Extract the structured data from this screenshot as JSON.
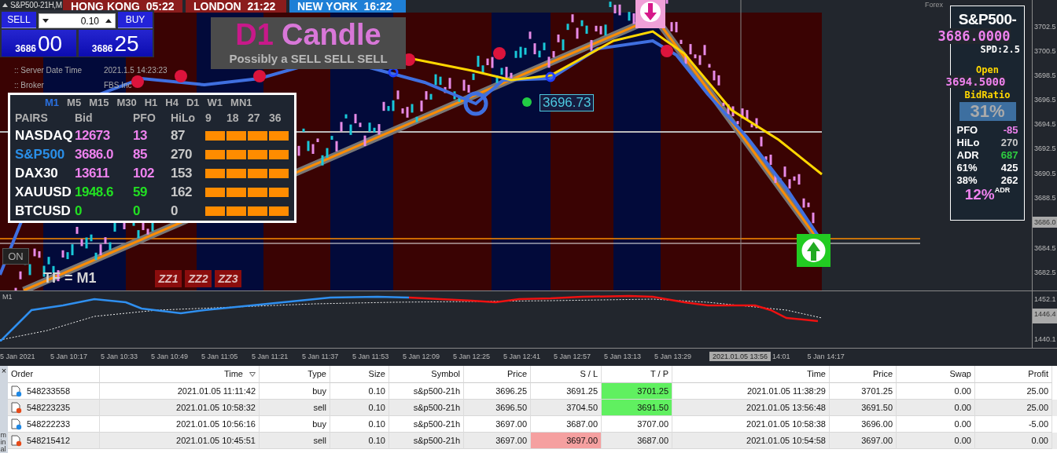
{
  "symbol_title": "S&P500-21H,M",
  "sessions": [
    {
      "city": "HONG KONG",
      "time": "05:22",
      "color": "#8b1c1c"
    },
    {
      "city": "LONDON",
      "time": "21:22",
      "color": "#8b1c1c"
    },
    {
      "city": "NEW YORK",
      "time": "16:22",
      "color": "#1e7fd6"
    }
  ],
  "trade_panel": {
    "sell": "SELL",
    "buy": "BUY",
    "lot": "0.10",
    "bid_main": "3686",
    "bid_pips": "00",
    "ask_main": "3686",
    "ask_pips": "25"
  },
  "banner": {
    "title_parts": [
      {
        "text": "D1",
        "color": "#c8198a"
      },
      {
        "text": "Candle",
        "color": "#d877d8"
      }
    ],
    "subtitle": "Possibly a SELL SELL SELL"
  },
  "info_lines": [
    {
      "label": ":: Server Date Time",
      "value": "2021.1.5   14:23:23"
    },
    {
      "label": ":: Broker",
      "value": "FBS Inc"
    }
  ],
  "dashboard": {
    "timeframes": [
      {
        "label": "M1",
        "selected": true
      },
      {
        "label": "M5",
        "selected": false
      },
      {
        "label": "M15",
        "selected": false
      },
      {
        "label": "M30",
        "selected": false
      },
      {
        "label": "H1",
        "selected": false
      },
      {
        "label": "H4",
        "selected": false
      },
      {
        "label": "D1",
        "selected": false
      },
      {
        "label": "W1",
        "selected": false
      },
      {
        "label": "MN1",
        "selected": false
      }
    ],
    "headers": [
      "PAIRS",
      "Bid",
      "PFO",
      "HiLo",
      "9",
      "18",
      "27",
      "36"
    ],
    "rows": [
      {
        "pair": "NASDAQ",
        "bid": "12673",
        "pfo": "13",
        "hilo": "87",
        "selected": false,
        "color": "#ee82ee",
        "signals": [
          {
            "color": "#ff8c00"
          },
          {
            "color": "#ff8c00"
          },
          {
            "color": "#ff8c00"
          },
          {
            "color": "#ff8c00"
          }
        ]
      },
      {
        "pair": "S&P500",
        "bid": "3686.0",
        "pfo": "85",
        "hilo": "270",
        "selected": true,
        "color": "#ee82ee",
        "signals": [
          {
            "color": "#ff8c00"
          },
          {
            "color": "#ff8c00"
          },
          {
            "color": "#ff8c00"
          },
          {
            "color": "#ff8c00"
          }
        ]
      },
      {
        "pair": "DAX30",
        "bid": "13611",
        "pfo": "102",
        "hilo": "153",
        "selected": false,
        "color": "#ee82ee",
        "signals": [
          {
            "color": "#ff8c00"
          },
          {
            "color": "#ff8c00"
          },
          {
            "color": "#ff8c00"
          },
          {
            "color": "#ff8c00"
          }
        ]
      },
      {
        "pair": "XAUUSD",
        "bid": "1948.6",
        "pfo": "59",
        "hilo": "162",
        "selected": false,
        "color": "#22e022",
        "signals": [
          {
            "color": "#ff8c00"
          },
          {
            "color": "#ff8c00"
          },
          {
            "color": "#ff8c00"
          },
          {
            "color": "#ff8c00"
          }
        ]
      },
      {
        "pair": "BTCUSD",
        "bid": "0",
        "pfo": "0",
        "hilo": "0",
        "selected": false,
        "color": "#22e022",
        "signals": [
          {
            "color": "#ff8c00"
          },
          {
            "color": "#ff8c00"
          },
          {
            "color": "#ff8c00"
          },
          {
            "color": "#ff8c00"
          }
        ]
      }
    ]
  },
  "on_button": "ON",
  "tf_label": "TF = M1",
  "zz_buttons": [
    "ZZ1",
    "ZZ2",
    "ZZ3"
  ],
  "price_marker": "3696.73",
  "forex_label": "Forex",
  "price_axis": [
    {
      "text": "3702.5",
      "highlighted": false
    },
    {
      "text": "3700.5",
      "highlighted": false
    },
    {
      "text": "3698.5",
      "highlighted": false
    },
    {
      "text": "3696.5",
      "highlighted": false
    },
    {
      "text": "3694.5",
      "highlighted": false
    },
    {
      "text": "3692.5",
      "highlighted": false
    },
    {
      "text": "3690.5",
      "highlighted": false
    },
    {
      "text": "3688.5",
      "highlighted": false
    },
    {
      "text": "3686.0",
      "highlighted": true
    },
    {
      "text": "3684.5",
      "highlighted": false
    },
    {
      "text": "3682.5",
      "highlighted": false
    }
  ],
  "side_panel": {
    "symbol": "S&P500-",
    "price": "3686.0000",
    "spread": "SPD:2.5",
    "open_label": "Open",
    "open": "3694.5000",
    "ratio_label": "BidRatio",
    "ratio": "31%",
    "stats": [
      {
        "label": "PFO",
        "value": "-85",
        "color": "#ee82ee"
      },
      {
        "label": "HiLo",
        "value": "270",
        "color": "#c8c8c8"
      },
      {
        "label": "ADR",
        "value": "687",
        "color": "#2ecc40"
      },
      {
        "label": "61%",
        "value": "425",
        "color": "#ffffff"
      },
      {
        "label": "38%",
        "value": "262",
        "color": "#ffffff"
      }
    ],
    "adr_pct": "12%",
    "adr_label": "ADR"
  },
  "indicator": {
    "label": "M1",
    "axis": [
      {
        "text": "1452.1",
        "highlighted": false
      },
      {
        "text": "1446.4",
        "highlighted": true
      },
      {
        "text": "1440.1",
        "highlighted": false
      }
    ]
  },
  "time_axis": {
    "labels": [
      "5 Jan 2021",
      "5 Jan 10:17",
      "5 Jan 10:33",
      "5 Jan 10:49",
      "5 Jan 11:05",
      "5 Jan 11:21",
      "5 Jan 11:37",
      "5 Jan 11:53",
      "5 Jan 12:09",
      "5 Jan 12:25",
      "5 Jan 12:41",
      "5 Jan 12:57",
      "5 Jan 13:13",
      "5 Jan 13:29"
    ],
    "cursor": "2021.01.05 13:56",
    "after_cursor": [
      "14:01",
      "5 Jan 14:17"
    ]
  },
  "terminal": {
    "close": "×",
    "side_tab": "minal",
    "columns": [
      "Order",
      "Time",
      "Type",
      "Size",
      "Symbol",
      "Price",
      "S / L",
      "T / P",
      "Time",
      "Price",
      "Swap",
      "Profit"
    ],
    "rows": [
      {
        "kind": "buy",
        "cells": [
          "548233558",
          "2021.01.05 11:11:42",
          "buy",
          "0.10",
          "s&p500-21h",
          "3696.25",
          "3691.25",
          "3701.25",
          "2021.01.05 11:38:29",
          "3701.25",
          "0.00",
          "25.00"
        ],
        "sl_hit": false,
        "tp_hit": true
      },
      {
        "kind": "sell",
        "cells": [
          "548223235",
          "2021.01.05 10:58:32",
          "sell",
          "0.10",
          "s&p500-21h",
          "3696.50",
          "3704.50",
          "3691.50",
          "2021.01.05 13:56:48",
          "3691.50",
          "0.00",
          "25.00"
        ],
        "sl_hit": false,
        "tp_hit": true
      },
      {
        "kind": "buy",
        "cells": [
          "548222233",
          "2021.01.05 10:56:16",
          "buy",
          "0.10",
          "s&p500-21h",
          "3697.00",
          "3687.00",
          "3707.00",
          "2021.01.05 10:58:38",
          "3696.00",
          "0.00",
          "-5.00"
        ],
        "sl_hit": false,
        "tp_hit": false
      },
      {
        "kind": "sell",
        "cells": [
          "548215412",
          "2021.01.05 10:45:51",
          "sell",
          "0.10",
          "s&p500-21h",
          "3697.00",
          "3697.00",
          "3687.00",
          "2021.01.05 10:54:58",
          "3697.00",
          "0.00",
          "0.00"
        ],
        "sl_hit": true,
        "tp_hit": false
      }
    ]
  }
}
